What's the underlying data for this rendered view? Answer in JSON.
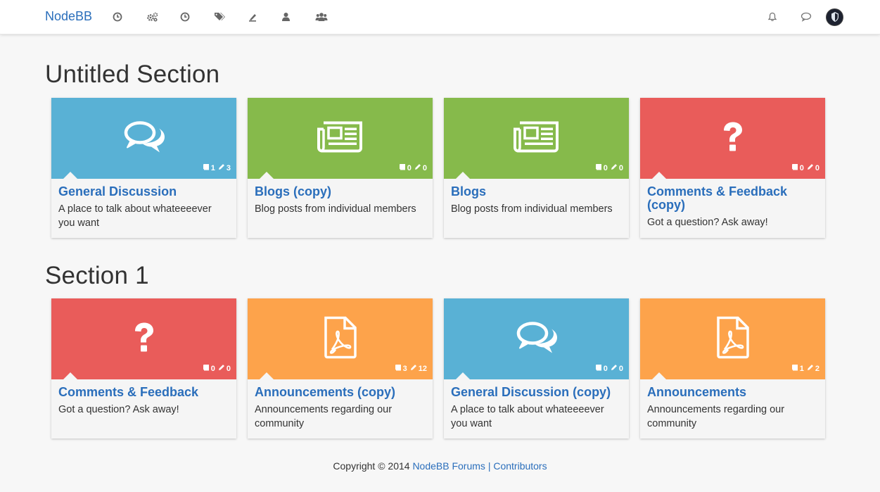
{
  "brand": "NodeBB",
  "nav": {
    "left_icons": [
      "clock-icon",
      "cogs-icon",
      "clock-icon",
      "tags-icon",
      "fire-icon",
      "user-icon",
      "group-icon"
    ],
    "right_icons": [
      "bell-icon",
      "chat-icon",
      "avatar"
    ]
  },
  "sections": [
    {
      "title": "Untitled Section",
      "categories": [
        {
          "name": "General Discussion",
          "description": "A place to talk about whateeeever you want",
          "color": "#59b1d5",
          "icon": "comments-icon",
          "topics": "1",
          "posts": "3"
        },
        {
          "name": "Blogs (copy)",
          "description": "Blog posts from individual members",
          "color": "#86ba4b",
          "icon": "newspaper-icon",
          "topics": "0",
          "posts": "0"
        },
        {
          "name": "Blogs",
          "description": "Blog posts from individual members",
          "color": "#86ba4b",
          "icon": "newspaper-icon",
          "topics": "0",
          "posts": "0"
        },
        {
          "name": "Comments & Feedback (copy)",
          "description": "Got a question? Ask away!",
          "color": "#e95c5a",
          "icon": "question-icon",
          "topics": "0",
          "posts": "0"
        }
      ]
    },
    {
      "title": "Section 1",
      "categories": [
        {
          "name": "Comments & Feedback",
          "description": "Got a question? Ask away!",
          "color": "#e95c5a",
          "icon": "question-icon",
          "topics": "0",
          "posts": "0"
        },
        {
          "name": "Announcements (copy)",
          "description": "Announcements regarding our community",
          "color": "#fda34b",
          "icon": "pdf-file-icon",
          "topics": "3",
          "posts": "12"
        },
        {
          "name": "General Discussion (copy)",
          "description": "A place to talk about whateeeever you want",
          "color": "#59b1d5",
          "icon": "comments-icon",
          "topics": "0",
          "posts": "0"
        },
        {
          "name": "Announcements",
          "description": "Announcements regarding our community",
          "color": "#fda34b",
          "icon": "pdf-file-icon",
          "topics": "1",
          "posts": "2"
        }
      ]
    }
  ],
  "footer": {
    "copyright": "Copyright © 2014",
    "forums_link": "NodeBB Forums",
    "separator": "|",
    "contributors_link": "Contributors"
  }
}
